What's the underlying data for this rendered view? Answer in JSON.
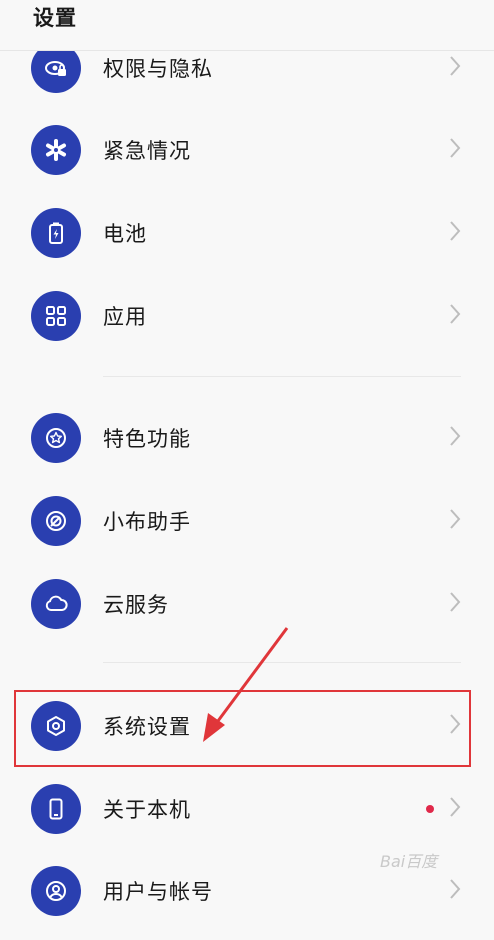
{
  "header": {
    "title": "设置"
  },
  "items": [
    {
      "label": "权限与隐私",
      "icon": "privacy-eye-lock-icon"
    },
    {
      "label": "紧急情况",
      "icon": "emergency-asterisk-icon"
    },
    {
      "label": "电池",
      "icon": "battery-icon"
    },
    {
      "label": "应用",
      "icon": "apps-grid-icon"
    },
    {
      "label": "特色功能",
      "icon": "star-badge-icon"
    },
    {
      "label": "小布助手",
      "icon": "assistant-icon"
    },
    {
      "label": "云服务",
      "icon": "cloud-icon"
    },
    {
      "label": "系统设置",
      "icon": "hexagon-settings-icon"
    },
    {
      "label": "关于本机",
      "icon": "phone-icon"
    },
    {
      "label": "用户与帐号",
      "icon": "user-icon"
    }
  ],
  "colors": {
    "icon_bg": "#2a3fb0",
    "highlight": "#e0363a",
    "badge_dot": "#e0294a"
  },
  "watermark": "Bai百度"
}
